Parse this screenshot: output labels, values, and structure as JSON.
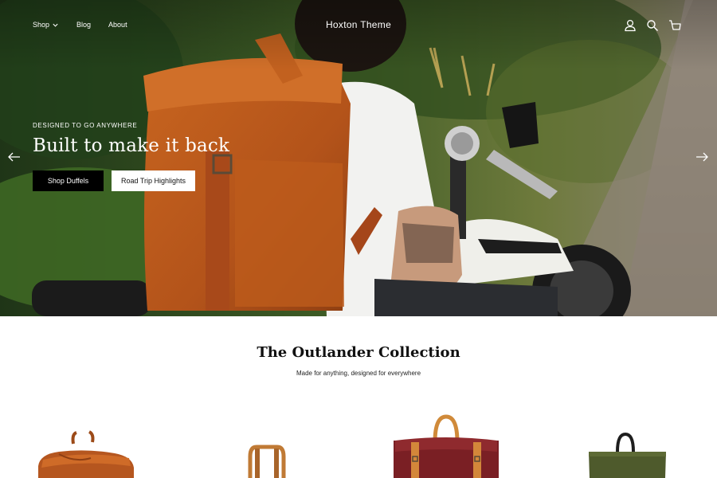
{
  "header": {
    "nav": [
      {
        "label": "Shop",
        "has_dropdown": true
      },
      {
        "label": "Blog"
      },
      {
        "label": "About"
      }
    ],
    "brand": "Hoxton Theme",
    "icons": [
      "account-icon",
      "search-icon",
      "cart-icon"
    ]
  },
  "hero": {
    "eyebrow": "DESIGNED TO GO ANYWHERE",
    "headline": "Built to make it back",
    "primary_button": "Shop Duffels",
    "secondary_button": "Road Trip Highlights",
    "prev_icon": "arrow-left-icon",
    "next_icon": "arrow-right-icon"
  },
  "collection": {
    "title": "The Outlander Collection",
    "subtitle": "Made for anything, designed for everywhere",
    "products": [
      {
        "name": "tan-rolltop-backpack",
        "color": "#b5561f"
      },
      {
        "name": "tan-leather-tote",
        "color": "#c07a35"
      },
      {
        "name": "burgundy-rolltop-backpack",
        "color": "#7a1f24"
      },
      {
        "name": "olive-canvas-tote",
        "color": "#4e5a2c"
      }
    ]
  },
  "colors": {
    "primary_button_bg": "#000000",
    "secondary_button_bg": "#ffffff",
    "hero_text": "#ffffff"
  }
}
